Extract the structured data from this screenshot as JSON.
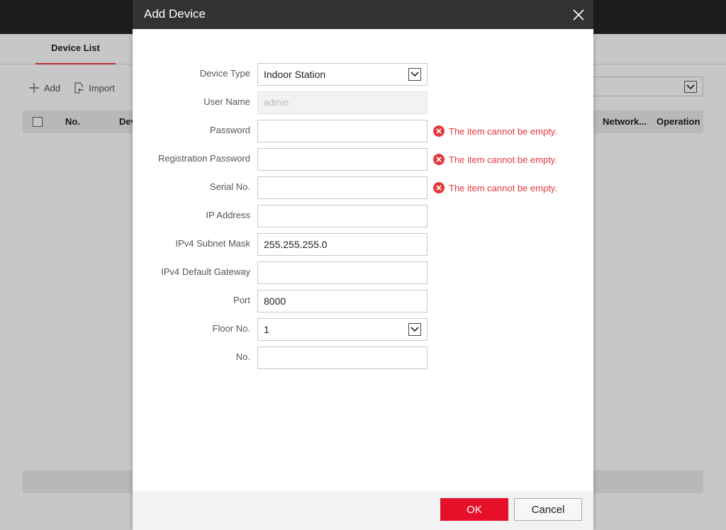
{
  "background": {
    "tab_device_list": "Device List",
    "toolbar": {
      "add_label": "Add",
      "import_label": "Import"
    },
    "table_headers": {
      "no": "No.",
      "device_partial": "Dev",
      "network": "Network...",
      "operation": "Operation"
    }
  },
  "dialog": {
    "title": "Add Device",
    "fields": {
      "device_type": {
        "label": "Device Type",
        "value": "Indoor Station"
      },
      "user_name": {
        "label": "User Name",
        "value": "admin"
      },
      "password": {
        "label": "Password",
        "value": "",
        "error": "The item cannot be empty."
      },
      "registration_password": {
        "label": "Registration Password",
        "value": "",
        "error": "The item cannot be empty."
      },
      "serial_no": {
        "label": "Serial No.",
        "value": "",
        "error": "The item cannot be empty."
      },
      "ip_address": {
        "label": "IP Address",
        "value": ""
      },
      "subnet_mask": {
        "label": "IPv4 Subnet Mask",
        "value": "255.255.255.0"
      },
      "default_gateway": {
        "label": "IPv4 Default Gateway",
        "value": ""
      },
      "port": {
        "label": "Port",
        "value": "8000"
      },
      "floor_no": {
        "label": "Floor No.",
        "value": "1"
      },
      "no": {
        "label": "No.",
        "value": ""
      }
    },
    "ok_label": "OK",
    "cancel_label": "Cancel"
  },
  "colors": {
    "accent": "#e6102a",
    "error": "#e4393c",
    "header": "#333333",
    "topbar": "#262626"
  }
}
